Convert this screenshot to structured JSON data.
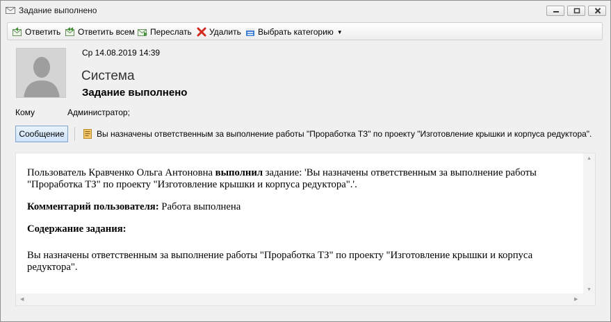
{
  "window": {
    "title": "Задание выполнено"
  },
  "toolbar": {
    "reply": "Ответить",
    "reply_all": "Ответить всем",
    "forward": "Переслать",
    "delete": "Удалить",
    "category": "Выбрать категорию"
  },
  "message": {
    "date": "Ср 14.08.2019 14:39",
    "sender": "Система",
    "subject": "Задание выполнено",
    "to_label": "Кому",
    "to_value": "Администратор;",
    "tab_label": "Сообщение",
    "attachment": "Вы назначены ответственным за выполнение работы \"Проработка ТЗ\" по проекту \"Изготовление крышки и корпуса редуктора\"."
  },
  "body": {
    "p1_pre": "Пользователь Кравченко Ольга Антоновна ",
    "p1_bold": "выполнил",
    "p1_post": " задание: 'Вы назначены ответственным за выполнение работы \"Проработка ТЗ\" по проекту \"Изготовление крышки и корпуса редуктора\".'.",
    "comment_label": "Комментарий пользователя:",
    "comment_value": " Работа выполнена",
    "content_label": "Содержание задания:",
    "content_text": "Вы назначены ответственным за выполнение работы \"Проработка ТЗ\" по проекту \"Изготовление крышки и корпуса редуктора\"."
  }
}
